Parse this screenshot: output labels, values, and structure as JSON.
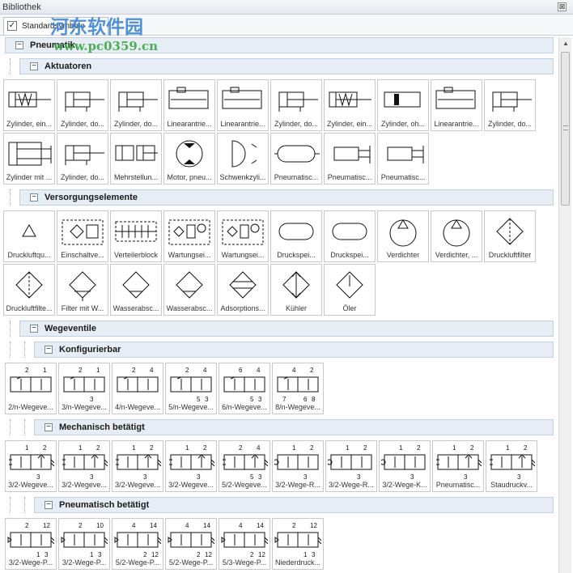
{
  "window": {
    "title": "Bibliothek",
    "close_glyph": "⊠"
  },
  "tab": {
    "label": "Standardsymbole",
    "checked": true
  },
  "watermark": {
    "name": "河东软件园",
    "url": "www.pc0359.cn"
  },
  "groups": [
    {
      "title": "Pneumatik",
      "level": 0,
      "toggle": "−",
      "items": []
    },
    {
      "title": "Aktuatoren",
      "level": 1,
      "toggle": "−",
      "items": [
        {
          "label": "Zylinder, ein...",
          "icon": "single-acting-cylinder-icon"
        },
        {
          "label": "Zylinder, do...",
          "icon": "double-acting-cylinder-icon"
        },
        {
          "label": "Zylinder, do...",
          "icon": "double-acting-cylinder-icon"
        },
        {
          "label": "Linearantrie...",
          "icon": "linear-drive-icon"
        },
        {
          "label": "Linearantrie...",
          "icon": "linear-drive-icon"
        },
        {
          "label": "Zylinder, do...",
          "icon": "double-acting-cylinder-icon"
        },
        {
          "label": "Zylinder, ein...",
          "icon": "single-acting-cylinder-icon"
        },
        {
          "label": "Zylinder, oh...",
          "icon": "cylinder-no-rod-icon"
        },
        {
          "label": "Linearantrie...",
          "icon": "linear-drive-icon"
        },
        {
          "label": "Zylinder, do...",
          "icon": "double-acting-cylinder-icon"
        },
        {
          "label": "Zylinder mit ...",
          "icon": "cylinder-with-guide-icon"
        },
        {
          "label": "Zylinder, do...",
          "icon": "double-acting-cylinder-icon"
        },
        {
          "label": "Mehrstellun...",
          "icon": "multi-position-cylinder-icon"
        },
        {
          "label": "Motor, pneu...",
          "icon": "pneumatic-motor-icon"
        },
        {
          "label": "Schwenkzyli...",
          "icon": "rotary-actuator-icon"
        },
        {
          "label": "Pneumatisc...",
          "icon": "pneumatic-muscle-icon"
        },
        {
          "label": "Pneumatisc...",
          "icon": "pneumatic-gripper-icon"
        },
        {
          "label": "Pneumatisc...",
          "icon": "pneumatic-gripper-icon"
        }
      ]
    },
    {
      "title": "Versorgungselemente",
      "level": 1,
      "toggle": "−",
      "items": [
        {
          "label": "Druckluftqu...",
          "icon": "air-source-icon"
        },
        {
          "label": "Einschaltve...",
          "icon": "start-up-valve-icon"
        },
        {
          "label": "Verteilerblock",
          "icon": "distributor-block-icon"
        },
        {
          "label": "Wartungsei...",
          "icon": "service-unit-icon"
        },
        {
          "label": "Wartungsei...",
          "icon": "service-unit-icon"
        },
        {
          "label": "Druckspei...",
          "icon": "pressure-reservoir-icon"
        },
        {
          "label": "Druckspei...",
          "icon": "pressure-reservoir-icon"
        },
        {
          "label": "Verdichter",
          "icon": "compressor-icon"
        },
        {
          "label": "Verdichter, ...",
          "icon": "compressor-icon"
        },
        {
          "label": "Druckluftfilter",
          "icon": "air-filter-icon"
        },
        {
          "label": "Druckluftfilte...",
          "icon": "air-filter-icon"
        },
        {
          "label": "Filter mit W...",
          "icon": "filter-with-drain-icon"
        },
        {
          "label": "Wasserabsc...",
          "icon": "water-separator-icon"
        },
        {
          "label": "Wasserabsc...",
          "icon": "water-separator-icon"
        },
        {
          "label": "Adsorptions...",
          "icon": "adsorption-dryer-icon"
        },
        {
          "label": "Kühler",
          "icon": "cooler-icon"
        },
        {
          "label": "Öler",
          "icon": "lubricator-icon"
        }
      ]
    },
    {
      "title": "Wegeventile",
      "level": 1,
      "toggle": "−",
      "items": []
    },
    {
      "title": "Konfigurierbar",
      "level": 2,
      "toggle": "−",
      "items": [
        {
          "label": "2/n-Wegeve...",
          "icon": "directional-valve-icon",
          "ports": [
            "1",
            "2"
          ]
        },
        {
          "label": "3/n-Wegeve...",
          "icon": "directional-valve-icon",
          "ports": [
            "1",
            "2",
            "3"
          ]
        },
        {
          "label": "4/n-Wegeve...",
          "icon": "directional-valve-icon",
          "ports": [
            "4",
            "2"
          ]
        },
        {
          "label": "5/n-Wegeve...",
          "icon": "directional-valve-icon",
          "ports": [
            "4",
            "2",
            "5",
            "3"
          ]
        },
        {
          "label": "6/n-Wegeve...",
          "icon": "directional-valve-icon",
          "ports": [
            "4",
            "6",
            "5",
            "3"
          ]
        },
        {
          "label": "8/n-Wegeve...",
          "icon": "directional-valve-icon",
          "ports": [
            "2",
            "4",
            "6",
            "8",
            "7"
          ]
        }
      ]
    },
    {
      "title": "Mechanisch betätigt",
      "level": 2,
      "toggle": "−",
      "items": [
        {
          "label": "3/2-Wegeve...",
          "icon": "mechanical-valve-icon",
          "ports": [
            "2",
            "1",
            "3"
          ]
        },
        {
          "label": "3/2-Wegeve...",
          "icon": "mechanical-valve-icon",
          "ports": [
            "2",
            "1",
            "3"
          ]
        },
        {
          "label": "3/2-Wegeve...",
          "icon": "mechanical-valve-icon",
          "ports": [
            "2",
            "1",
            "3"
          ]
        },
        {
          "label": "3/2-Wegeve...",
          "icon": "mechanical-valve-icon",
          "ports": [
            "2",
            "1",
            "3"
          ]
        },
        {
          "label": "5/2-Wegeve...",
          "icon": "mechanical-valve-icon",
          "ports": [
            "4",
            "2",
            "5",
            "3"
          ]
        },
        {
          "label": "3/2-Wege-R...",
          "icon": "roller-valve-icon",
          "ports": [
            "2",
            "1",
            "3"
          ]
        },
        {
          "label": "3/2-Wege-R...",
          "icon": "roller-valve-icon",
          "ports": [
            "2",
            "1",
            "3"
          ]
        },
        {
          "label": "3/2-Wege-K...",
          "icon": "roller-valve-icon",
          "ports": [
            "2",
            "1",
            "3"
          ]
        },
        {
          "label": "Pneumatisc...",
          "icon": "mechanical-valve-icon",
          "ports": [
            "2",
            "1",
            "3"
          ]
        },
        {
          "label": "Staudruckv...",
          "icon": "mechanical-valve-icon",
          "ports": [
            "2",
            "1",
            "3"
          ]
        }
      ]
    },
    {
      "title": "Pneumatisch betätigt",
      "level": 2,
      "toggle": "−",
      "items": [
        {
          "label": "3/2-Wege-P...",
          "icon": "pneumatic-valve-icon",
          "ports": [
            "12",
            "2",
            "1",
            "3"
          ]
        },
        {
          "label": "3/2-Wege-P...",
          "icon": "pneumatic-valve-icon",
          "ports": [
            "10",
            "2",
            "1",
            "3"
          ]
        },
        {
          "label": "5/2-Wege-P...",
          "icon": "pneumatic-valve-icon",
          "ports": [
            "14",
            "4",
            "2",
            "12"
          ]
        },
        {
          "label": "5/2-Wege-P...",
          "icon": "pneumatic-valve-icon",
          "ports": [
            "14",
            "4",
            "2",
            "12"
          ]
        },
        {
          "label": "5/3-Wege-P...",
          "icon": "pneumatic-valve-icon",
          "ports": [
            "14",
            "4",
            "2",
            "12"
          ]
        },
        {
          "label": "Niederdruck...",
          "icon": "pneumatic-valve-icon",
          "ports": [
            "12",
            "2",
            "1",
            "3"
          ]
        }
      ]
    },
    {
      "title": "",
      "level": 2,
      "toggle": "",
      "items": []
    }
  ]
}
